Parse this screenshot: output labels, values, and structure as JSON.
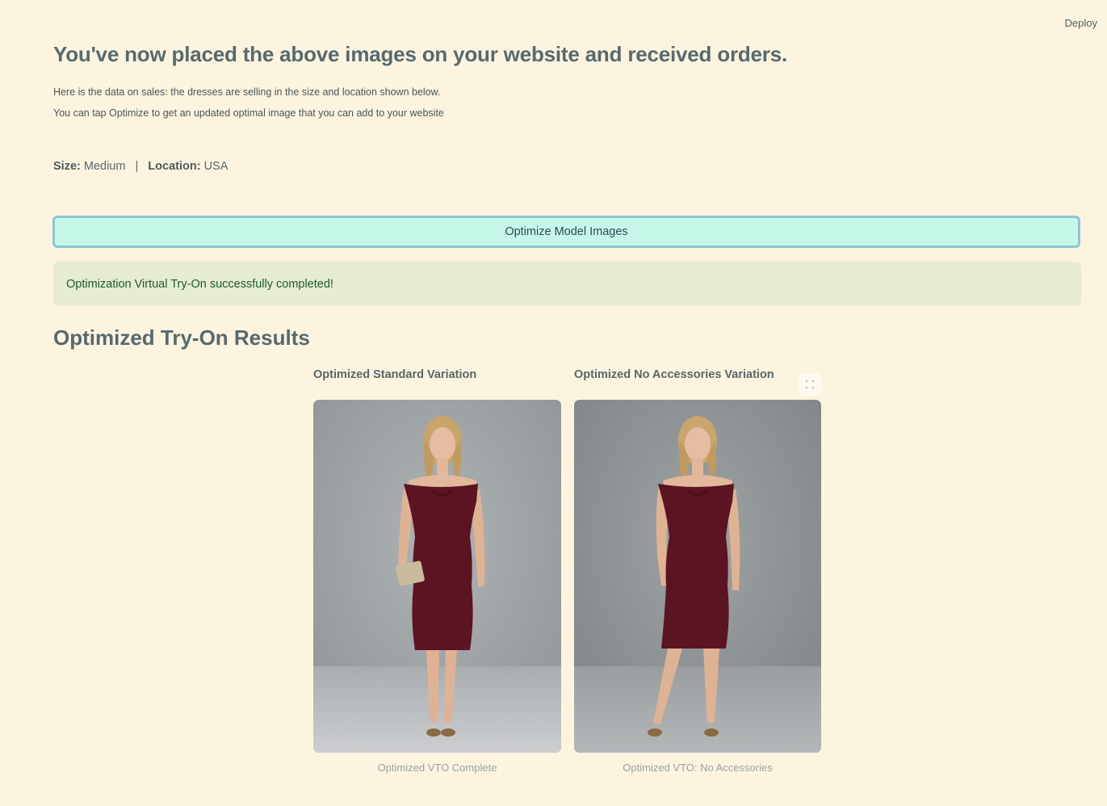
{
  "header": {
    "deploy_label": "Deploy"
  },
  "main": {
    "title": "You've now placed the above images on your website and received orders.",
    "description_line1": "Here is the data on sales: the dresses are selling in the size and location shown below.",
    "description_line2": "You can tap Optimize to get an updated optimal image that you can add to your website",
    "size_label": "Size:",
    "size_value": "Medium",
    "separator": "|",
    "location_label": "Location:",
    "location_value": "USA",
    "optimize_button_label": "Optimize Model Images",
    "success_message": "Optimization Virtual Try-On successfully completed!",
    "results_title": "Optimized Try-On Results"
  },
  "results": [
    {
      "title": "Optimized Standard Variation",
      "caption": "Optimized VTO Complete"
    },
    {
      "title": "Optimized No Accessories Variation",
      "caption": "Optimized VTO: No Accessories"
    }
  ],
  "icons": {
    "expand": "fullscreen-expand-icon"
  },
  "colors": {
    "background": "#fdf4df",
    "button_bg": "#c6f8ea",
    "button_border": "#8fc6d6",
    "success_bg": "#e5ecd1",
    "success_text": "#1d5a2c",
    "dress": "#5c1322"
  }
}
